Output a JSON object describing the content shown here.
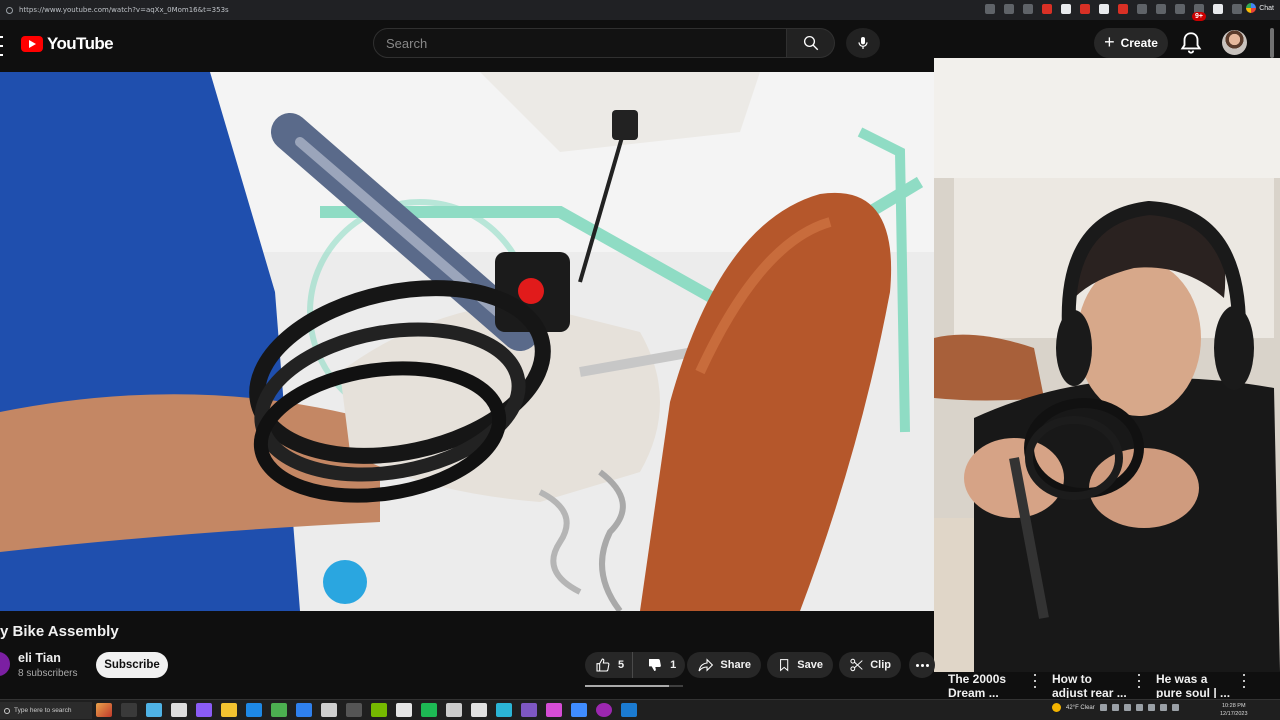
{
  "browser": {
    "url": "https://www.youtube.com/watch?v=aqXx_0Mom16&t=353s",
    "chat_label": "Chat"
  },
  "header": {
    "logo_text": "YouTube",
    "search_placeholder": "Search",
    "create_label": "Create",
    "notification_badge": "9+"
  },
  "video": {
    "title": "y Bike Assembly",
    "channel": "eli Tian",
    "subscribers": "8 subscribers",
    "subscribe_label": "Subscribe",
    "likes": "5",
    "dislikes": "1",
    "share_label": "Share",
    "save_label": "Save",
    "clip_label": "Clip",
    "progress_fraction": 0.86
  },
  "recommendations": [
    {
      "line1": "The 2000s",
      "line2": "Dream ..."
    },
    {
      "line1": "How to",
      "line2": "adjust rear ..."
    },
    {
      "line1": "He was a",
      "line2": "pure soul | ..."
    }
  ],
  "taskbar": {
    "search_placeholder": "Type here to search",
    "weather": "42°F  Clear",
    "time": "10:28 PM",
    "date": "12/17/2023"
  },
  "colors": {
    "brand_red": "#ff0000",
    "bg": "#0f0f0f",
    "pill": "#272727"
  }
}
